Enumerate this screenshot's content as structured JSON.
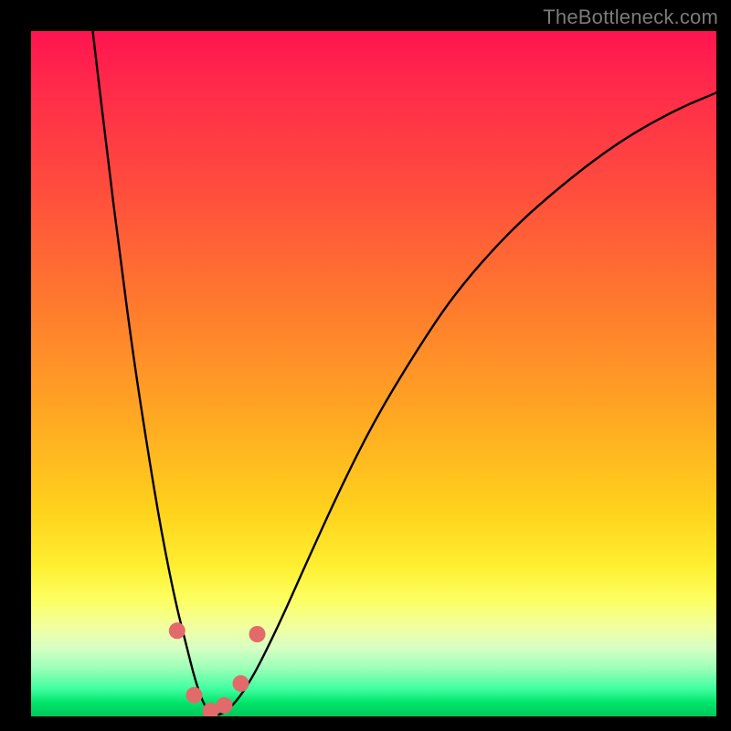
{
  "watermark": "TheBottleneck.com",
  "chart_data": {
    "type": "line",
    "title": "",
    "xlabel": "",
    "ylabel": "",
    "xlim": [
      0,
      100
    ],
    "ylim": [
      0,
      100
    ],
    "grid": false,
    "legend": false,
    "series": [
      {
        "name": "bottleneck-curve",
        "x": [
          9,
          11,
          13,
          15,
          17,
          19,
          21,
          22.5,
          24,
          25.5,
          27,
          29,
          32,
          36,
          40,
          45,
          50,
          56,
          62,
          70,
          78,
          86,
          94,
          100
        ],
        "y": [
          100,
          83,
          67,
          52,
          39,
          27,
          17,
          11,
          5,
          1,
          0,
          1,
          5,
          13,
          22,
          33,
          43,
          53,
          62,
          71,
          78,
          84,
          88.5,
          91
        ]
      }
    ],
    "markers": [
      {
        "name": "dot-left-upper",
        "x": 21.3,
        "y": 12.5
      },
      {
        "name": "dot-left-lower",
        "x": 23.8,
        "y": 3.1
      },
      {
        "name": "dot-center-left",
        "x": 26.2,
        "y": 0.8
      },
      {
        "name": "dot-center-right",
        "x": 28.2,
        "y": 1.6
      },
      {
        "name": "dot-right-lower",
        "x": 30.6,
        "y": 4.8
      },
      {
        "name": "dot-right-upper",
        "x": 33.0,
        "y": 12.0
      }
    ],
    "marker_style": {
      "color": "#e36a6a",
      "radius_px": 9
    }
  }
}
